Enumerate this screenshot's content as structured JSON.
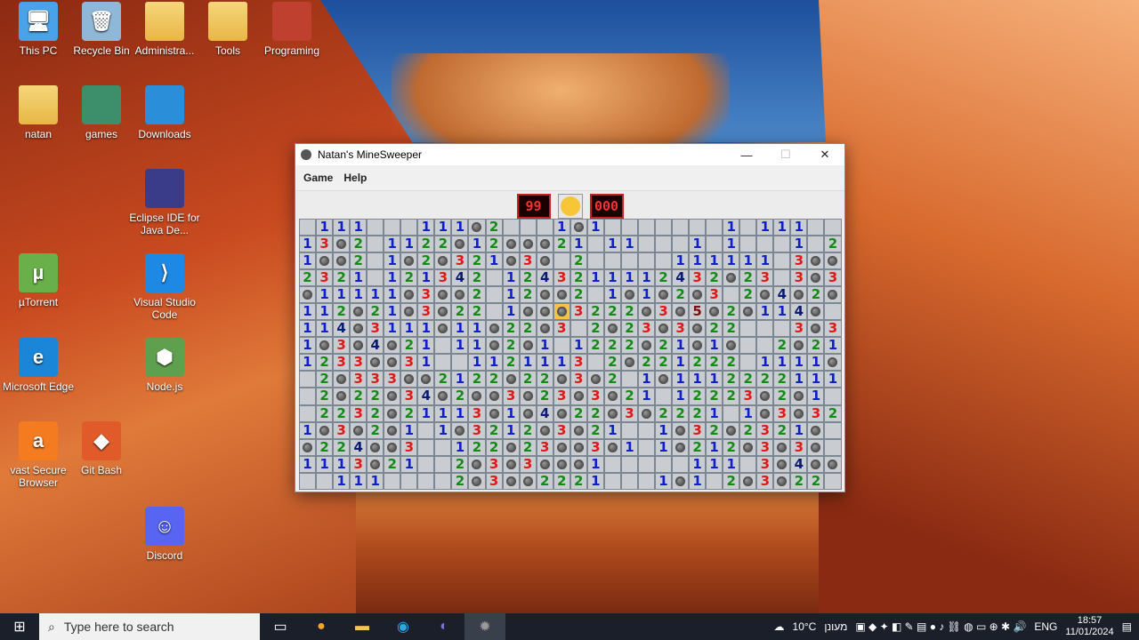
{
  "desktop": {
    "icons": [
      {
        "name": "this-pc-icon",
        "label": "This PC",
        "glyph": "🖥"
      },
      {
        "name": "recycle-bin-icon",
        "label": "Recycle Bin",
        "glyph": "🗑"
      },
      {
        "name": "administrator-folder-icon",
        "label": "Administra...",
        "glyph": ""
      },
      {
        "name": "tools-folder-icon",
        "label": "Tools",
        "glyph": ""
      },
      {
        "name": "programing-icon",
        "label": "Programing",
        "glyph": ""
      },
      {
        "name": "natan-folder-icon",
        "label": "natan",
        "glyph": ""
      },
      {
        "name": "games-folder-icon",
        "label": "games",
        "glyph": ""
      },
      {
        "name": "downloads-folder-icon",
        "label": "Downloads",
        "glyph": ""
      },
      {
        "name": "eclipse-icon",
        "label": "Eclipse IDE for Java De...",
        "glyph": ""
      },
      {
        "name": "utorrent-icon",
        "label": "µTorrent",
        "glyph": "µ"
      },
      {
        "name": "vscode-icon",
        "label": "Visual Studio Code",
        "glyph": "⟩"
      },
      {
        "name": "edge-icon",
        "label": "Microsoft Edge",
        "glyph": "e"
      },
      {
        "name": "nodejs-icon",
        "label": "Node.js",
        "glyph": "⬢"
      },
      {
        "name": "avast-icon",
        "label": "vast Secure Browser",
        "glyph": "a"
      },
      {
        "name": "gitbash-icon",
        "label": "Git Bash",
        "glyph": "◆"
      },
      {
        "name": "discord-icon",
        "label": "Discord",
        "glyph": "☺"
      }
    ]
  },
  "window": {
    "title": "Natan's MineSweeper",
    "minimize": "—",
    "maximize": "☐",
    "close": "✕",
    "menu": [
      "Game",
      "Help"
    ],
    "mine_counter": "99",
    "timer": "000"
  },
  "board_rows": [
    "?111???111*2???1*1???????1?111???",
    "13*2?1122*12***21?11???1?1???1?2*3",
    "1**2?1*2*321*3*?2?????111111?3**",
    "2321?121342?1243211112432*23?3*3",
    "*11111*3**2?12**2?1*1*2*3?2*4*2*",
    "112*21*3*22?1**X3222*3*5*2*114*",
    "114*3111*11*22*3?2*23*3*22???3*3",
    "1*3*4*21?11*2*1?1222*21*1*??2*211",
    "1233**31??1121113?2*221222?1111*",
    "?2*333**2122*22*3*2?1*1112222111",
    "?2*22*34*2**3*23*3*21?12223*2*1",
    "?2232*21113*1*4*22*3*2221?1*3*3221",
    "1*3*2*1?1*3212*3*21??1*32*2321*",
    "*224**3??122*23**3*1?1*212*3*3*",
    "1113*21??2*3*3***1?????111?3*4**",
    "??111????2*3**2221???1*1?2*3*22"
  ],
  "taskbar": {
    "search_placeholder": "Type here to search",
    "weather": "10°C",
    "weather_label": "מעונן",
    "lang": "ENG",
    "time": "18:57",
    "date": "11/01/2024"
  }
}
